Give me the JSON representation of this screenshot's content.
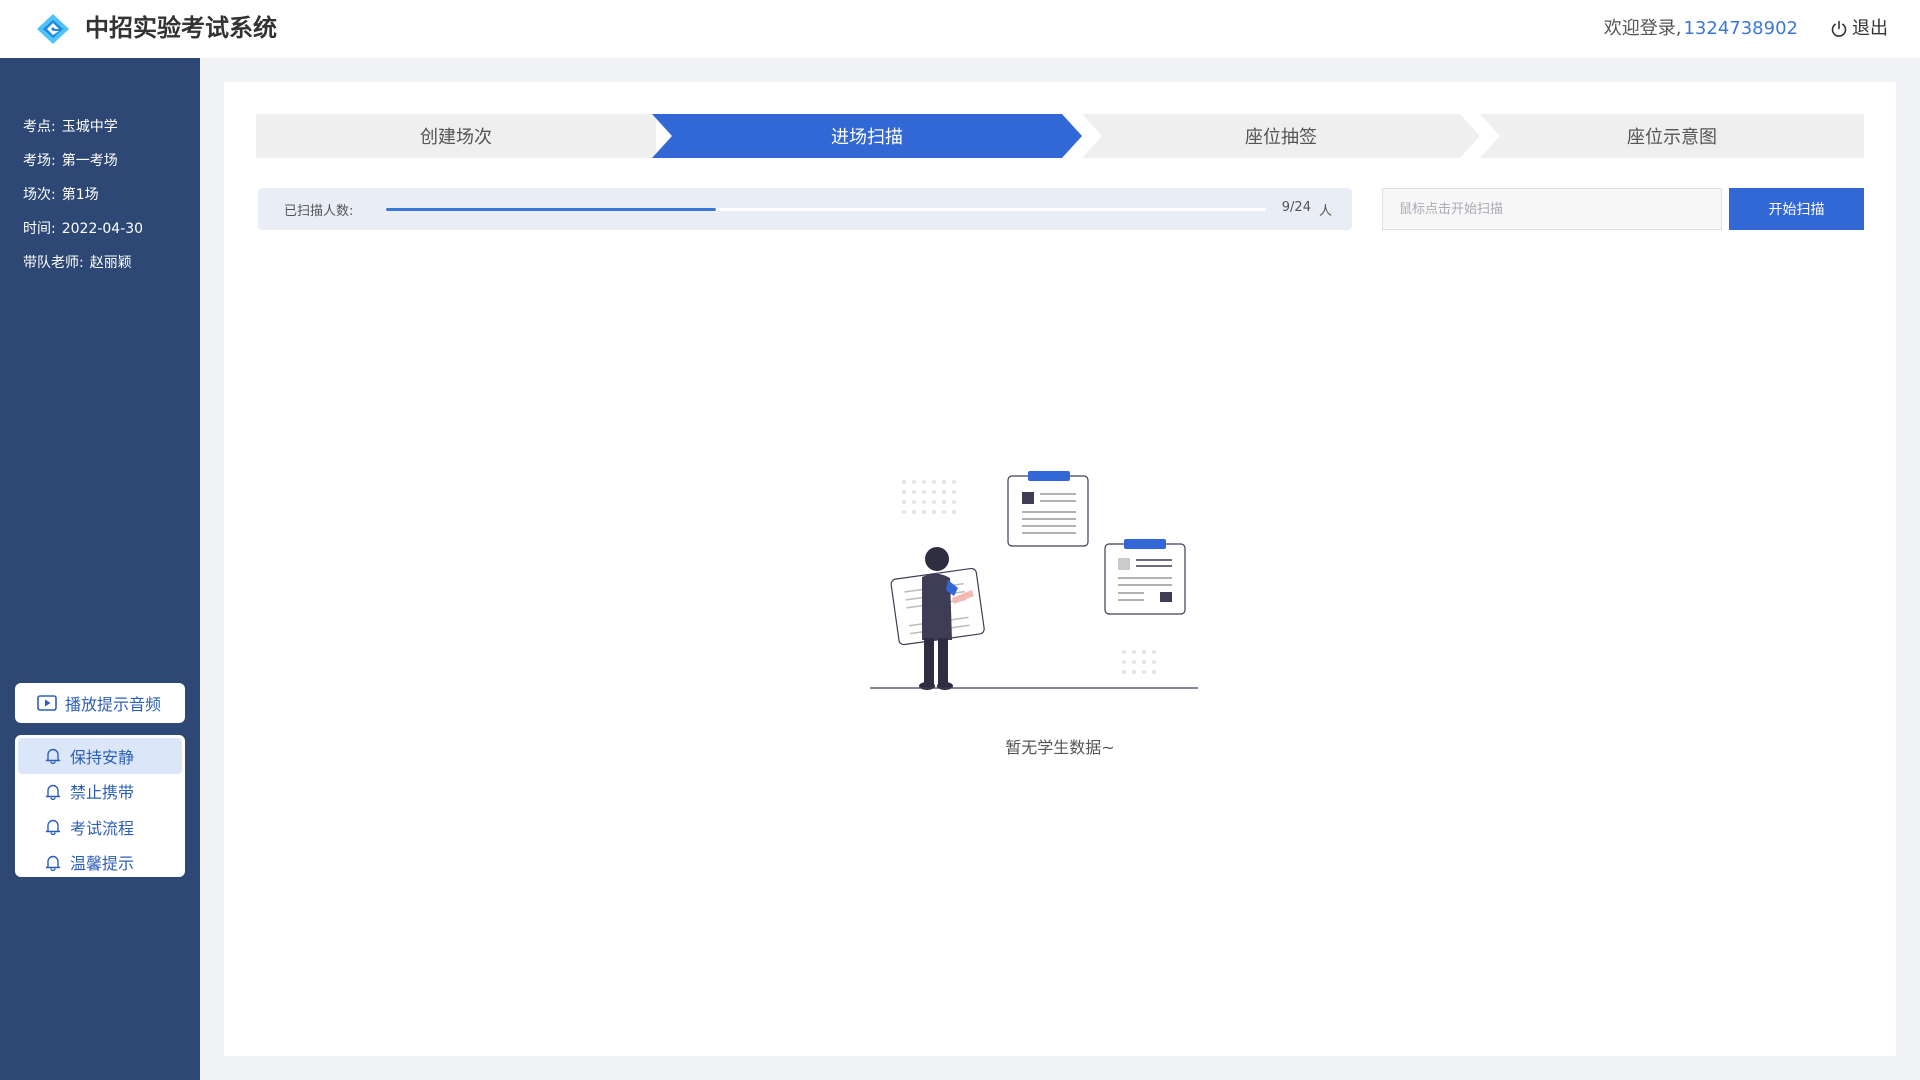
{
  "header": {
    "app_title": "中招实验考试系统",
    "welcome_text": "欢迎登录,",
    "username": "1324738902",
    "logout_label": "退出"
  },
  "sidebar": {
    "info": [
      {
        "label": "考点:",
        "value": "玉城中学"
      },
      {
        "label": "考场:",
        "value": "第一考场"
      },
      {
        "label": "场次:",
        "value": "第1场"
      },
      {
        "label": "时间:",
        "value": "2022-04-30"
      },
      {
        "label": "带队老师:",
        "value": "赵丽颖"
      }
    ],
    "audio_button_label": "播放提示音频",
    "audio_items": [
      {
        "label": "保持安静",
        "active": true
      },
      {
        "label": "禁止携带",
        "active": false
      },
      {
        "label": "考试流程",
        "active": false
      },
      {
        "label": "温馨提示",
        "active": false
      }
    ]
  },
  "steps": [
    {
      "label": "创建场次",
      "active": false
    },
    {
      "label": "进场扫描",
      "active": true
    },
    {
      "label": "座位抽签",
      "active": false
    },
    {
      "label": "座位示意图",
      "active": false
    }
  ],
  "progress": {
    "label": "已扫描人数:",
    "scanned": 9,
    "total": 24,
    "count_text": "9/24",
    "unit": "人"
  },
  "scan": {
    "placeholder": "鼠标点击开始扫描",
    "button_label": "开始扫描"
  },
  "empty": {
    "message": "暂无学生数据~"
  },
  "colors": {
    "sidebar_bg": "#2e4875",
    "accent": "#3267d6",
    "step_inactive": "#efefef",
    "progress_bg": "#e9eef6"
  }
}
